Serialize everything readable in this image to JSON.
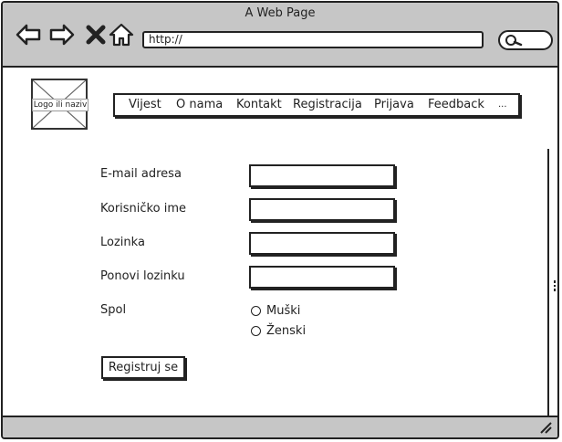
{
  "window": {
    "title": "A Web Page"
  },
  "browser": {
    "url": "http://",
    "icons": [
      "back-arrow-icon",
      "forward-arrow-icon",
      "close-icon",
      "home-icon",
      "search-icon",
      "resize-icon"
    ]
  },
  "header": {
    "logo_label": "Logo ili naziv",
    "menu": [
      "Vijest",
      "O nama",
      "Kontakt",
      "Registracija",
      "Prijava",
      "Feedback",
      "..."
    ]
  },
  "form": {
    "email_label": "E-mail adresa",
    "username_label": "Korisničko ime",
    "password_label": "Lozinka",
    "repeat_password_label": "Ponovi lozinku",
    "gender_label": "Spol",
    "gender_options": [
      "Muški",
      "Ženski"
    ],
    "submit_label": "Registruj se"
  }
}
